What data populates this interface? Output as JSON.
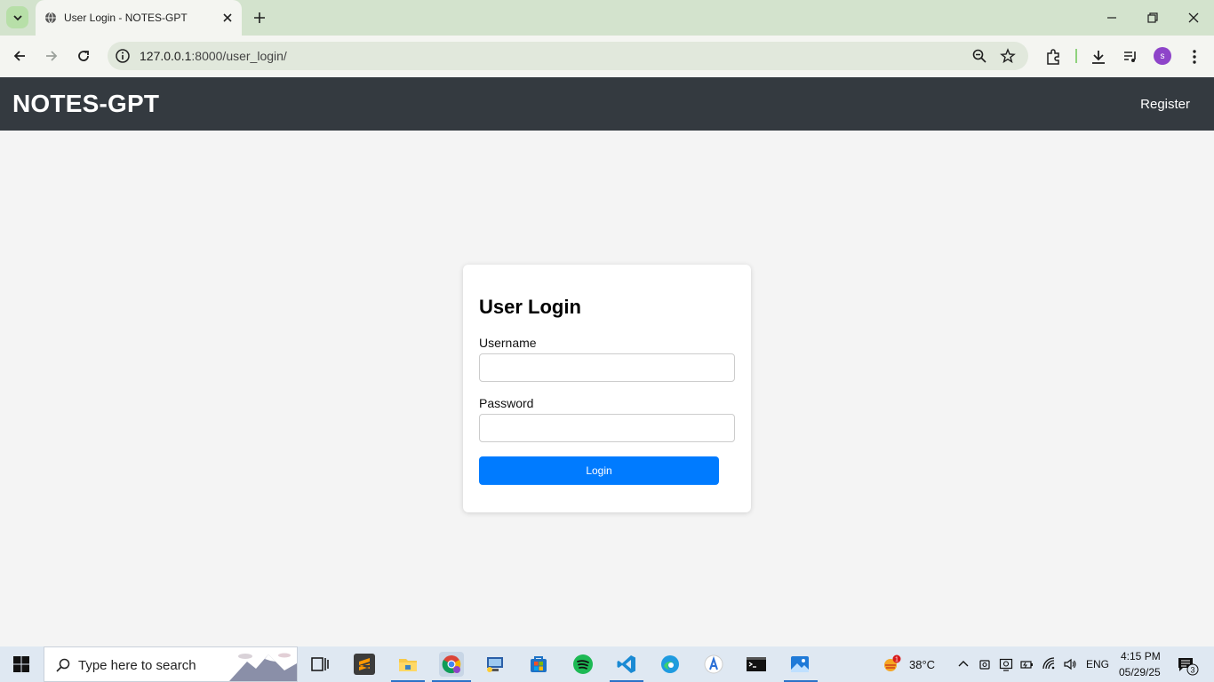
{
  "browser": {
    "tab_title": "User Login - NOTES-GPT",
    "url_host": "127.0.0.1",
    "url_path": ":8000/user_login/",
    "profile_initial": "s"
  },
  "site": {
    "brand": "NOTES-GPT",
    "nav_register": "Register"
  },
  "login_form": {
    "title": "User Login",
    "username_label": "Username",
    "username_value": "",
    "password_label": "Password",
    "password_value": "",
    "submit_label": "Login"
  },
  "taskbar": {
    "search_placeholder": "Type here to search",
    "weather_temp": "38°C",
    "weather_badge": "1",
    "language": "ENG",
    "time": "4:15 PM",
    "date": "05/29/25",
    "notification_count": "3"
  },
  "colors": {
    "header_bg": "#343a40",
    "accent_button": "#007bff",
    "page_bg": "#f4f4f4",
    "tabstrip_bg": "#d3e3cd"
  }
}
